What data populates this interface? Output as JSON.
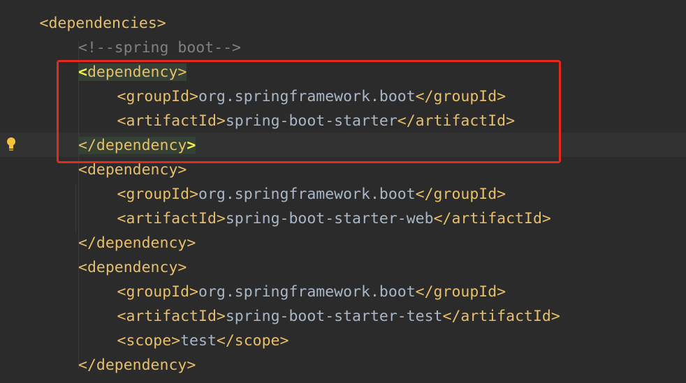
{
  "editor": {
    "language": "xml",
    "lines": [
      {
        "indent": 1,
        "parts": [
          {
            "t": "<dependencies>",
            "c": "tag"
          }
        ]
      },
      {
        "indent": 2,
        "parts": [
          {
            "t": "<!--spring boot-->",
            "c": "cmt"
          }
        ]
      },
      {
        "indent": 2,
        "parts": [
          {
            "t": "<",
            "c": "brace-match hl"
          },
          {
            "t": "dependency>",
            "c": "tag hl"
          }
        ]
      },
      {
        "indent": 3,
        "parts": [
          {
            "t": "<groupId>",
            "c": "tag"
          },
          {
            "t": "org.springframework.boot",
            "c": "txt"
          },
          {
            "t": "</groupId>",
            "c": "tag"
          }
        ]
      },
      {
        "indent": 3,
        "parts": [
          {
            "t": "<artifactId>",
            "c": "tag"
          },
          {
            "t": "spring-boot-starter",
            "c": "txt"
          },
          {
            "t": "</artifactId>",
            "c": "tag"
          }
        ]
      },
      {
        "indent": 2,
        "parts": [
          {
            "t": "</dependency",
            "c": "tag hl"
          },
          {
            "t": ">",
            "c": "brace-match hl"
          }
        ]
      },
      {
        "indent": 2,
        "parts": [
          {
            "t": "<dependency>",
            "c": "tag"
          }
        ]
      },
      {
        "indent": 3,
        "parts": [
          {
            "t": "<groupId>",
            "c": "tag"
          },
          {
            "t": "org.springframework.boot",
            "c": "txt"
          },
          {
            "t": "</groupId>",
            "c": "tag"
          }
        ]
      },
      {
        "indent": 3,
        "parts": [
          {
            "t": "<artifactId>",
            "c": "tag"
          },
          {
            "t": "spring-boot-starter-web",
            "c": "txt"
          },
          {
            "t": "</artifactId>",
            "c": "tag"
          }
        ]
      },
      {
        "indent": 2,
        "parts": [
          {
            "t": "</dependency>",
            "c": "tag"
          }
        ]
      },
      {
        "indent": 2,
        "parts": [
          {
            "t": "<dependency>",
            "c": "tag"
          }
        ]
      },
      {
        "indent": 3,
        "parts": [
          {
            "t": "<groupId>",
            "c": "tag"
          },
          {
            "t": "org.springframework.boot",
            "c": "txt"
          },
          {
            "t": "</groupId>",
            "c": "tag"
          }
        ]
      },
      {
        "indent": 3,
        "parts": [
          {
            "t": "<artifactId>",
            "c": "tag"
          },
          {
            "t": "spring-boot-starter-test",
            "c": "txt"
          },
          {
            "t": "</artifactId>",
            "c": "tag"
          }
        ]
      },
      {
        "indent": 3,
        "parts": [
          {
            "t": "<scope>",
            "c": "tag"
          },
          {
            "t": "test",
            "c": "txt"
          },
          {
            "t": "</scope>",
            "c": "tag"
          }
        ]
      },
      {
        "indent": 2,
        "parts": [
          {
            "t": "</dependency>",
            "c": "tag"
          }
        ]
      }
    ],
    "current_line": 6,
    "gutter_icon": "lightbulb-icon",
    "annotation": {
      "type": "highlight-box",
      "from_line": 3,
      "to_line": 6,
      "color": "#e12b21"
    }
  },
  "colors": {
    "background": "#2b2b2b",
    "tag": "#e8bf6a",
    "text": "#a9b7c6",
    "comment": "#808080",
    "match_highlight": "#344134",
    "annotation_border": "#e12b21"
  }
}
